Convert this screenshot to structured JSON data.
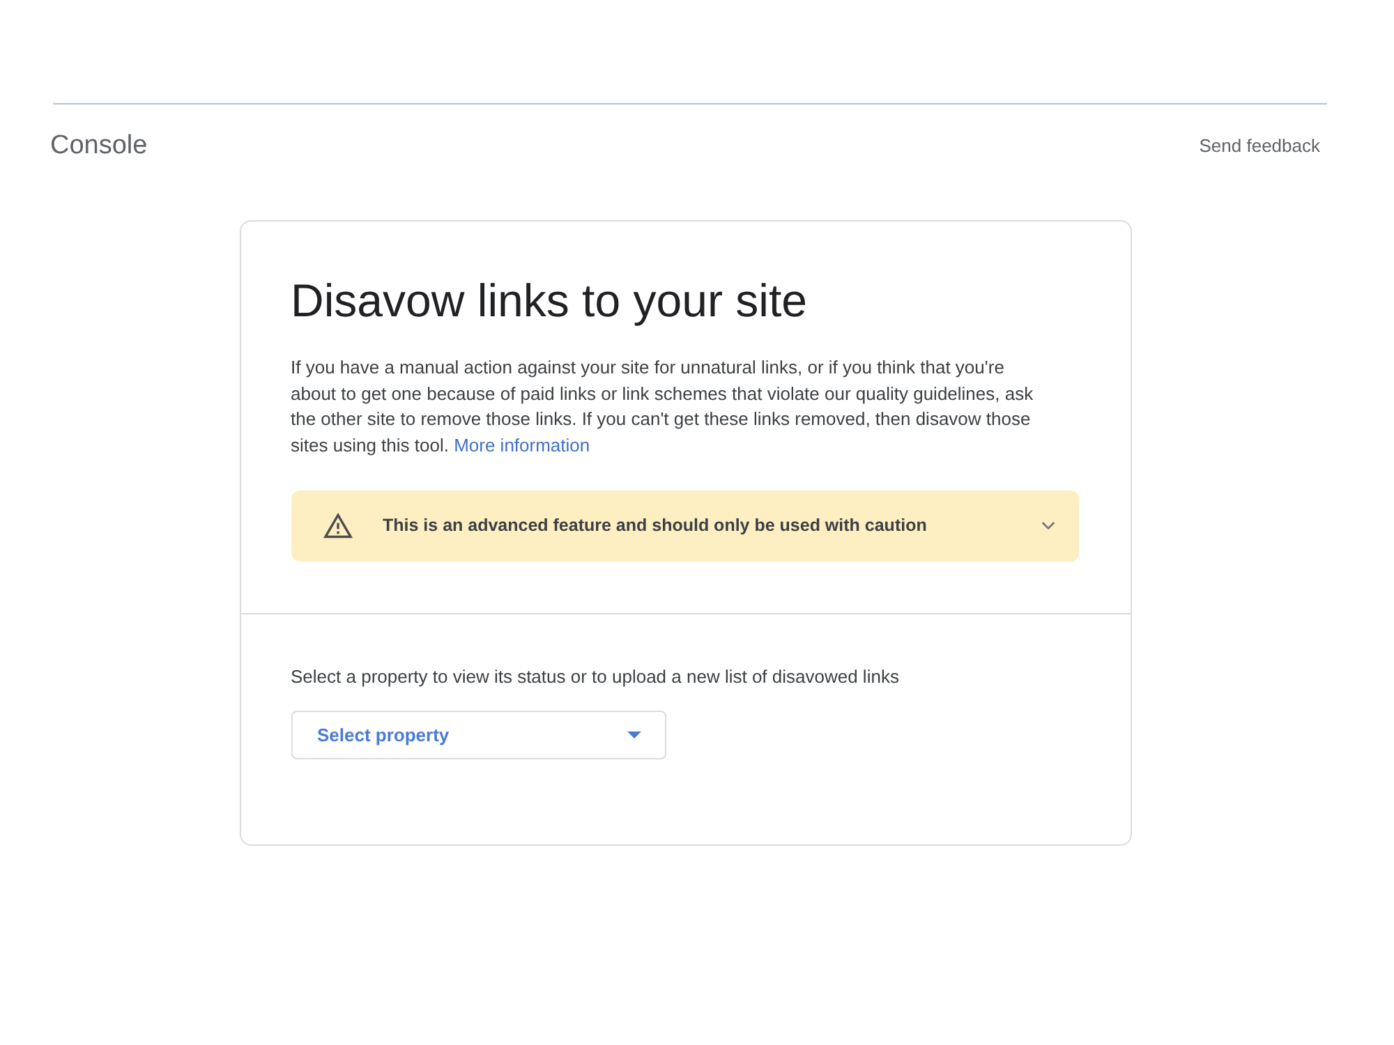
{
  "header": {
    "product": "Console",
    "feedback_link": "Send feedback"
  },
  "card": {
    "title": "Disavow links to your site",
    "description": "If you have a manual action against your site for unnatural links, or if you think that you're about to get one because of paid links or link schemes that violate our quality guidelines, ask the other site to remove those links. If you can't get these links removed, then disavow those sites using this tool.",
    "more_link": "More information",
    "alert": {
      "text": "This is an advanced feature and should only be used with caution",
      "expanded": false
    },
    "property_prompt": "Select a property to view its status or to upload a new list of disavowed links",
    "property_select": {
      "placeholder": "Select property"
    }
  }
}
